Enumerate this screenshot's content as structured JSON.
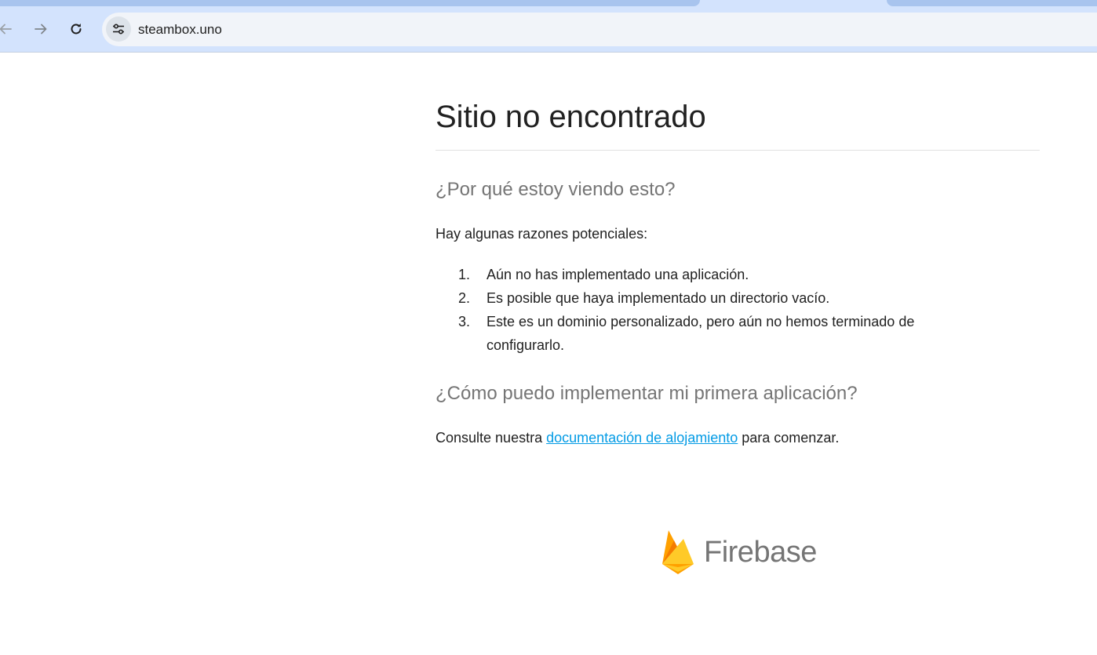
{
  "browser": {
    "url": "steambox.uno",
    "icons": {
      "back": "arrow-left-icon",
      "forward": "arrow-right-icon",
      "reload": "reload-icon",
      "site_info": "tune-icon"
    }
  },
  "page": {
    "title": "Sitio no encontrado",
    "why_heading": "¿Por qué estoy viendo esto?",
    "intro": "Hay algunas razones potenciales:",
    "reasons": [
      {
        "num": "1.",
        "text": "Aún no has implementado una aplicación."
      },
      {
        "num": "2.",
        "text": "Es posible que haya implementado un directorio vacío."
      },
      {
        "num": "3.",
        "text": "Este es un dominio personalizado, pero aún no hemos terminado de configurarlo."
      }
    ],
    "how_heading": "¿Cómo puedo implementar mi primera aplicación?",
    "consult_prefix": "Consulte nuestra ",
    "consult_link": "documentación de alojamiento",
    "consult_suffix": " para comenzar.",
    "brand": "Firebase"
  },
  "colors": {
    "link": "#039be5",
    "heading_gray": "#757575",
    "chrome_bg": "#d3e3fd",
    "flame_yellow": "#ffca28",
    "flame_orange": "#ffa000"
  }
}
